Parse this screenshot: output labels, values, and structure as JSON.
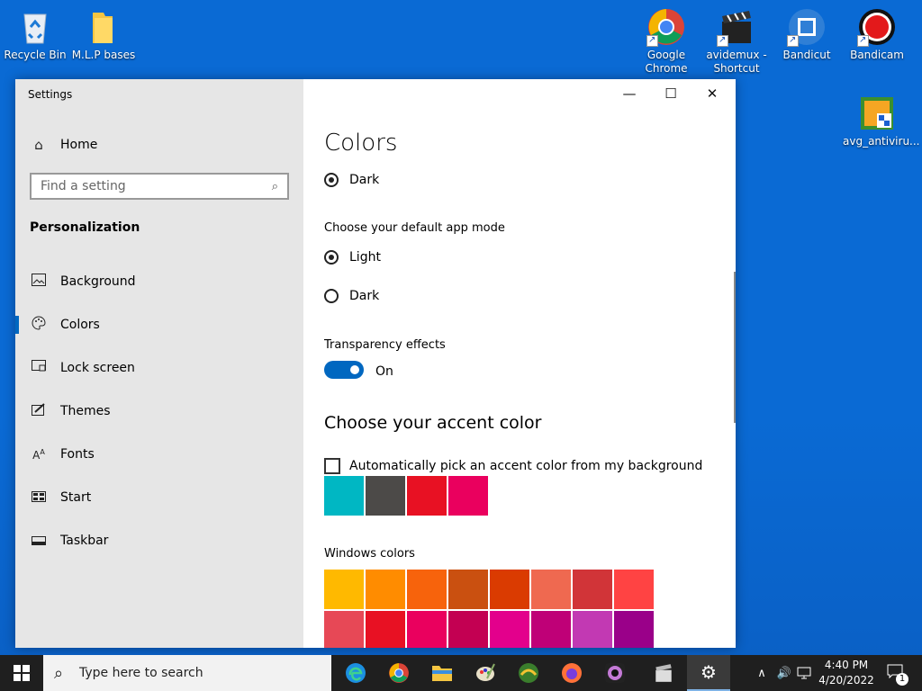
{
  "desktop": {
    "icons_left": [
      {
        "label": "Recycle Bin"
      },
      {
        "label": "M.L.P bases"
      }
    ],
    "icons_right": [
      {
        "label": "Google Chrome"
      },
      {
        "label": "avidemux - Shortcut"
      },
      {
        "label": "Bandicut"
      },
      {
        "label": "Bandicam"
      }
    ],
    "icon_avg": {
      "label": "avg_antiviru..."
    }
  },
  "window": {
    "title": "Settings",
    "controls": {
      "minimize": "—",
      "maximize": "☐",
      "close": "✕"
    }
  },
  "sidebar": {
    "home_label": "Home",
    "search_placeholder": "Find a setting",
    "section": "Personalization",
    "items": [
      {
        "label": "Background",
        "icon": "image-icon"
      },
      {
        "label": "Colors",
        "icon": "palette-icon",
        "active": true
      },
      {
        "label": "Lock screen",
        "icon": "lock-screen-icon"
      },
      {
        "label": "Themes",
        "icon": "brush-icon"
      },
      {
        "label": "Fonts",
        "icon": "font-icon"
      },
      {
        "label": "Start",
        "icon": "start-icon"
      },
      {
        "label": "Taskbar",
        "icon": "taskbar-icon"
      }
    ]
  },
  "main": {
    "title": "Colors",
    "windows_mode_dark": "Dark",
    "app_mode_heading": "Choose your default app mode",
    "app_mode_options": {
      "light": "Light",
      "dark": "Dark",
      "selected": "Light"
    },
    "transparency_heading": "Transparency effects",
    "transparency_state": "On",
    "accent_heading": "Choose your accent color",
    "auto_pick_label": "Automatically pick an accent color from my background",
    "recent_colors": [
      "#00b7c3",
      "#4c4a48",
      "#e81123",
      "#ea005e"
    ],
    "windows_colors_heading": "Windows colors",
    "windows_colors": [
      [
        "#ffb900",
        "#ff8c00",
        "#f7630c",
        "#ca5010",
        "#da3b01",
        "#ef6950",
        "#d13438",
        "#ff4343"
      ],
      [
        "#e74856",
        "#e81123",
        "#ea005e",
        "#c30052",
        "#e3008c",
        "#bf0077",
        "#c239b3",
        "#9a0089"
      ]
    ]
  },
  "taskbar": {
    "search_placeholder": "Type here to search",
    "time": "4:40 PM",
    "date": "4/20/2022",
    "notification_count": "1"
  }
}
